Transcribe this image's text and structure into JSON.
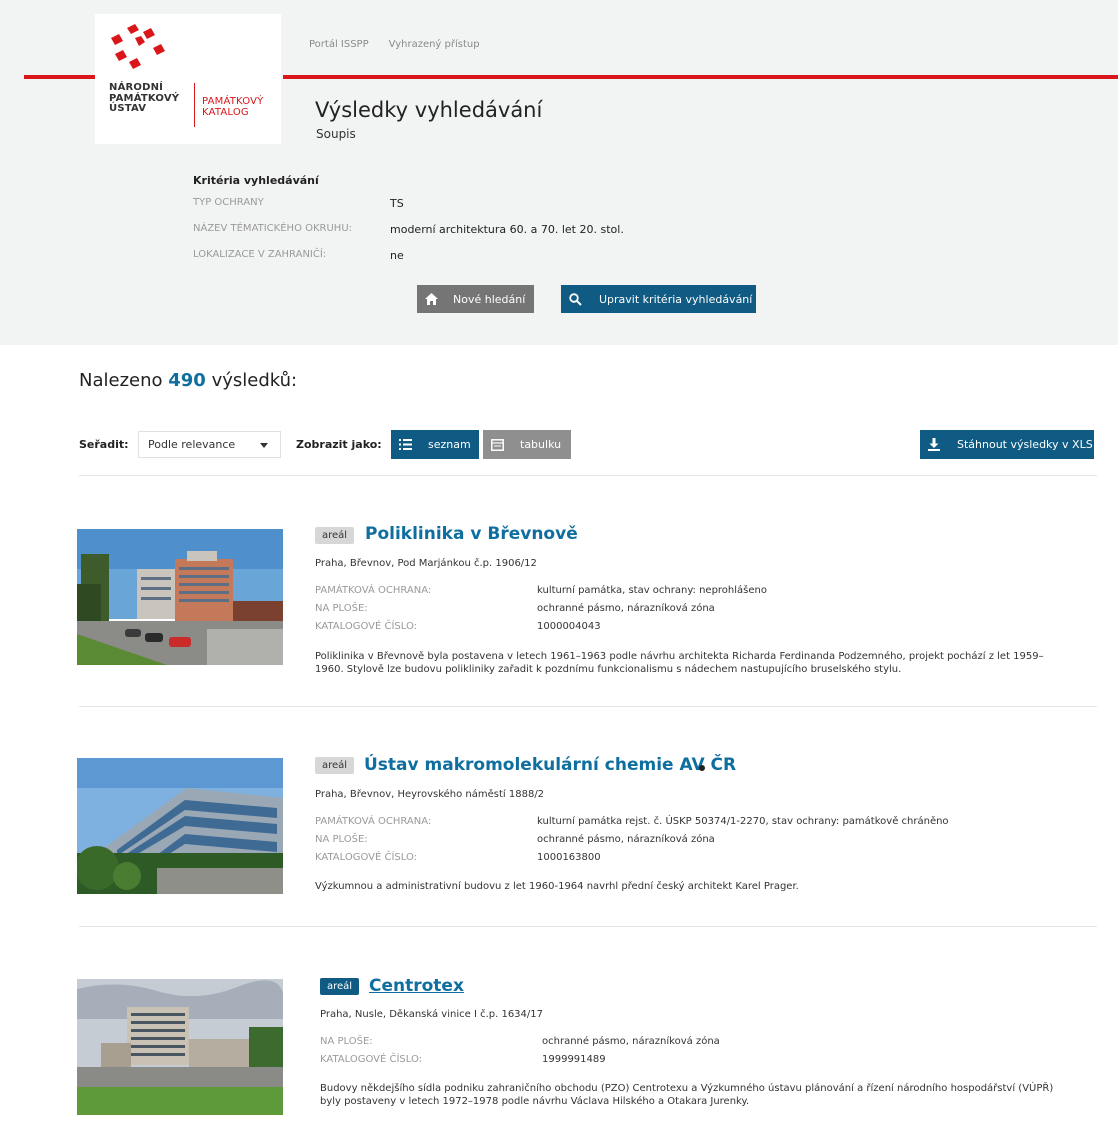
{
  "brand": {
    "org_lines": [
      "NÁRODNÍ",
      "PAMÁTKOVÝ",
      "ÚSTAV"
    ],
    "catalog_lines": [
      "PAMÁTKOVÝ",
      "KATALOG"
    ],
    "accent_color": "#d9161a"
  },
  "top_links": [
    "Portál ISSPP",
    "Vyhrazený přístup"
  ],
  "header": {
    "title": "Výsledky vyhledávání",
    "subtitle": "Soupis"
  },
  "criteria": {
    "heading": "Kritéria vyhledávání",
    "rows": [
      {
        "label": "TYP OCHRANY",
        "value": "TS"
      },
      {
        "label": "NÁZEV TÉMATICKÉHO OKRUHU:",
        "value": "moderní architektura 60. a 70. let 20. stol."
      },
      {
        "label": "LOKALIZACE V ZAHRANIČÍ:",
        "value": "ne"
      }
    ],
    "new_search_label": "Nové hledání",
    "edit_label": "Upravit kritéria vyhledávání"
  },
  "results_summary": {
    "prefix": "Nalezeno",
    "count": "490",
    "suffix": "výsledků:"
  },
  "toolbar": {
    "sort_label": "Seřadit:",
    "sort_value": "Podle relevance",
    "view_label": "Zobrazit jako:",
    "view_list": "seznam",
    "view_table": "tabulku",
    "download": "Stáhnout výsledky v XLS"
  },
  "results": [
    {
      "badge": "areál",
      "title": "Poliklinika v Břevnově",
      "address": "Praha, Břevnov, Pod Marjánkou č.p. 1906/12",
      "fields": [
        {
          "label": "PAMÁTKOVÁ OCHRANA:",
          "value": "kulturní památka, stav ochrany: neprohlášeno"
        },
        {
          "label": "NA PLOŠE:",
          "value": "ochranné pásmo, nárazníková zóna"
        },
        {
          "label": "KATALOGOVÉ ČÍSLO:",
          "value": "1000004043"
        }
      ],
      "description": "Poliklinika v Břevnově byla postavena v letech 1961–1963 podle návrhu architekta Richarda Ferdinanda Podzemného, projekt pochází z let 1959–1960. Stylově lze budovu polikliniky zařadit k pozdnímu funkcionalismu s nádechem nastupujícího bruselského stylu."
    },
    {
      "badge": "areál",
      "title": "Ústav makromolekulární chemie AV ČR",
      "address": "Praha, Břevnov, Heyrovského náměstí 1888/2",
      "fields": [
        {
          "label": "PAMÁTKOVÁ OCHRANA:",
          "value": "kulturní památka rejst. č. ÚSKP 50374/1-2270, stav ochrany: památkově chráněno"
        },
        {
          "label": "NA PLOŠE:",
          "value": "ochranné pásmo, nárazníková zóna"
        },
        {
          "label": "KATALOGOVÉ ČÍSLO:",
          "value": "1000163800"
        }
      ],
      "description": "Výzkumnou a administrativní budovu z let 1960-1964 navrhl přední český architekt Karel Prager."
    },
    {
      "badge": "areál",
      "title": "Centrotex",
      "address": "Praha, Nusle, Děkanská vinice I č.p. 1634/17",
      "fields": [
        {
          "label": "NA PLOŠE:",
          "value": "ochranné pásmo, nárazníková zóna"
        },
        {
          "label": "KATALOGOVÉ ČÍSLO:",
          "value": "1999991489"
        }
      ],
      "description": "Budovy někdejšího sídla podniku zahraničního obchodu (PZO) Centrotexu a Výzkumného ústavu plánování a řízení národního hospodářství (VÚPŘ) byly postaveny v letech 1972–1978 podle návrhu Václava Hilského a Otakara Jurenky."
    }
  ]
}
